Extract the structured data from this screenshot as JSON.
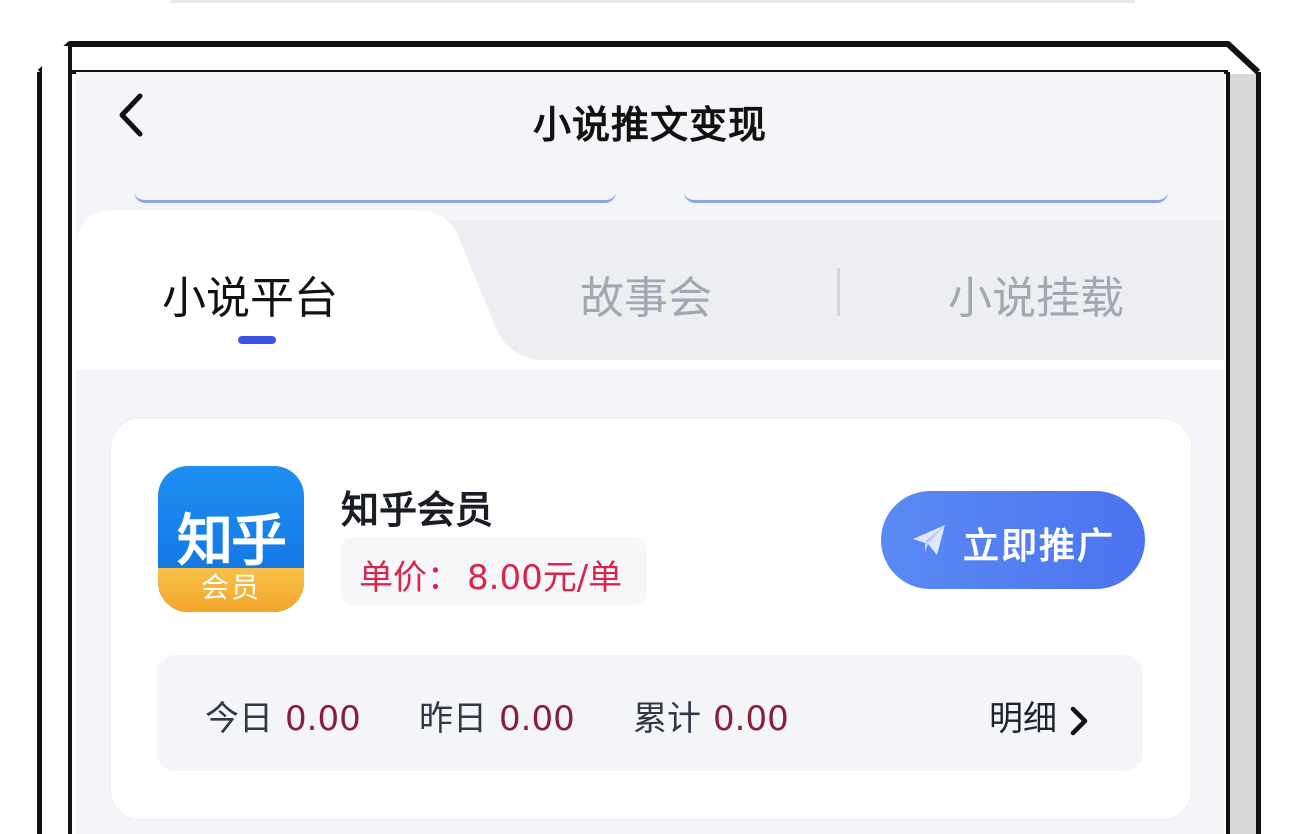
{
  "header": {
    "title": "小说推文变现",
    "back_icon": "chevron-left-icon"
  },
  "tabs": [
    {
      "label": "小说平台",
      "active": true
    },
    {
      "label": "故事会",
      "active": false
    },
    {
      "label": "小说挂载",
      "active": false
    }
  ],
  "card": {
    "app_icon": {
      "main_text": "知乎",
      "strip_text": "会员"
    },
    "app_name": "知乎会员",
    "price_label": "单价：",
    "price_value": "8.00元/单",
    "promote_button": {
      "label": "立即推广",
      "icon": "paper-plane-icon"
    },
    "stats": {
      "today_label": "今日",
      "today_value": "0.00",
      "yesterday_label": "昨日",
      "yesterday_value": "0.00",
      "total_label": "累计",
      "total_value": "0.00"
    },
    "detail_link": "明细"
  },
  "colors": {
    "accent": "#3a55e6",
    "button": "#4b73ef",
    "price": "#d9254c",
    "stat_value": "#8a1e3a"
  }
}
